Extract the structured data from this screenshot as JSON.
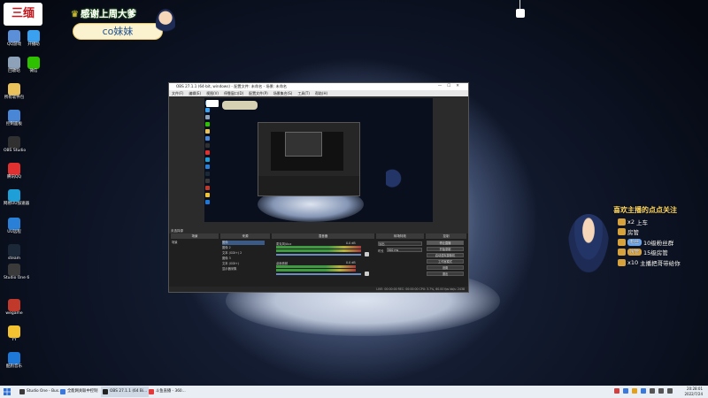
{
  "desktop": {
    "icons": [
      {
        "label": "QQ游戏",
        "icon": "qq-game-icon",
        "color": "#5b8fd8"
      },
      {
        "label": "开播助",
        "icon": "chat-bubble-icon",
        "color": "#3aa0f0"
      },
      {
        "label": "回收站",
        "icon": "recycle-bin-icon",
        "color": "#8da1b8"
      },
      {
        "label": "微信",
        "icon": "wechat-icon",
        "color": "#2dc100"
      },
      {
        "label": "所有软件包",
        "icon": "folder-icon",
        "color": "#e9c25c"
      },
      {
        "label": "控制面板",
        "icon": "control-panel-icon",
        "color": "#4a86d6"
      },
      {
        "label": "OBS Studio",
        "icon": "obs-icon",
        "color": "#303030"
      },
      {
        "label": "腾讯QQ",
        "icon": "qq-icon",
        "color": "#e03030"
      },
      {
        "label": "网易UU加速器",
        "icon": "uu-icon",
        "color": "#1f9fd8"
      },
      {
        "label": "UU远程",
        "icon": "uu-remote-icon",
        "color": "#2a7fd6"
      },
      {
        "label": "steam",
        "icon": "steam-icon",
        "color": "#1b2838"
      },
      {
        "label": "Studio One 6",
        "icon": "studio-one-icon",
        "color": "#3a3a3a"
      },
      {
        "label": "wegame",
        "icon": "wegame-icon",
        "color": "#c0392b"
      },
      {
        "label": "YY",
        "icon": "yy-icon",
        "color": "#f2c230"
      },
      {
        "label": "酷狗音乐",
        "icon": "kugou-icon",
        "color": "#1e78d8"
      }
    ]
  },
  "overlay": {
    "brand": "三缅",
    "thanks_title": "感谢上周大爹",
    "thanks_name": "co妹妹",
    "fans_panel": {
      "title": "喜欢主播的点点关注",
      "rows": [
        {
          "prefix": "x2",
          "text": "上车",
          "badge": ""
        },
        {
          "prefix": "",
          "text": "房管",
          "badge": ""
        },
        {
          "prefix": "",
          "text": "10级粉丝群",
          "badge": "粉丝"
        },
        {
          "prefix": "",
          "text": "15级房管",
          "badge": "房管"
        },
        {
          "prefix": "x10",
          "text": "主播把哥带给你",
          "badge": ""
        }
      ]
    }
  },
  "obs": {
    "title": "OBS 27.1.1 (64-bit, windows) - 配置文件: 未命名 - 场景: 未命名",
    "menu": [
      "文件(F)",
      "编辑(E)",
      "视图(V)",
      "停靠窗口(D)",
      "配置文件(P)",
      "场景集合(S)",
      "工具(T)",
      "帮助(H)"
    ],
    "scene_label": "未选择源",
    "docks": [
      "场景",
      "来源",
      "混音器",
      "转场特效",
      "控制"
    ],
    "scenes": [
      "场景"
    ],
    "sources": [
      "图像",
      "图像 2",
      "文本 (GDI+) 2",
      "图像 3",
      "文本 (GDI+)",
      "显示器采集"
    ],
    "mixer": [
      {
        "name": "麦克风/Aux",
        "level": "0.0 dB",
        "fill": 0.62
      },
      {
        "name": "桌面音频",
        "level": "0.0 dB",
        "fill": 0.58
      }
    ],
    "transition": {
      "type": "淡出",
      "duration_label": "时长",
      "duration": "300 ms"
    },
    "controls": [
      "停止直播",
      "开始录制",
      "启动虚拟摄像机",
      "工作室模式",
      "设置",
      "退出"
    ],
    "status": "LIVE: 00:00:00   REC: 00:00:00   CPU: 3.7%, 60.00 fps   kb/s: 2438"
  },
  "taskbar": {
    "items": [
      {
        "label": "Studio One - Bus...",
        "icon": "studio-one-icon",
        "color": "#3a3a3a"
      },
      {
        "label": "全能网关联中控制",
        "icon": "browser-icon",
        "color": "#3b78d8"
      },
      {
        "label": "OBS 27.1.1 (64 Bi...",
        "icon": "obs-icon",
        "color": "#222222",
        "active": true
      },
      {
        "label": "斗鱼直播 - 360...",
        "icon": "douyu-icon",
        "color": "#e03a3a"
      }
    ],
    "tray_icons": [
      "tray-app-1-icon",
      "tray-app-2-icon",
      "tray-app-3-icon",
      "tray-app-4-icon",
      "network-icon",
      "volume-icon",
      "ime-icon"
    ],
    "time": "20:28:01",
    "date": "2022/7/24"
  },
  "colors": {
    "accent": "#3c5a86",
    "thanks_pill_bg": "#fbf3cf",
    "fans_title": "#ffd966"
  }
}
